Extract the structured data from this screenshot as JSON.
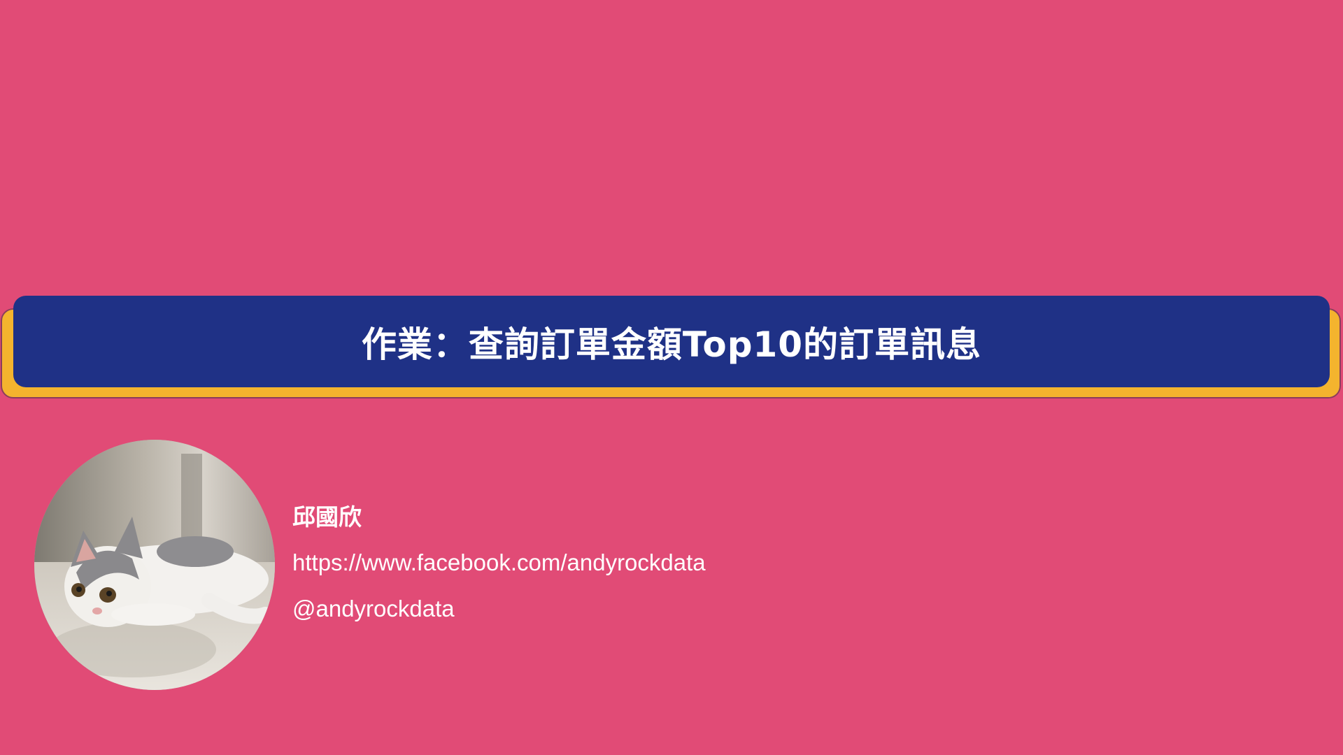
{
  "slide": {
    "title": "作業：查詢訂單金額Top10的訂單訊息",
    "background_color": "#E14B76",
    "banner_color": "#1F3186",
    "banner_shadow_color": "#F4B42E"
  },
  "author": {
    "avatar_icon": "cat-photo",
    "name": "邱國欣",
    "facebook_url": "https://www.facebook.com/andyrockdata",
    "handle": "@andyrockdata"
  }
}
